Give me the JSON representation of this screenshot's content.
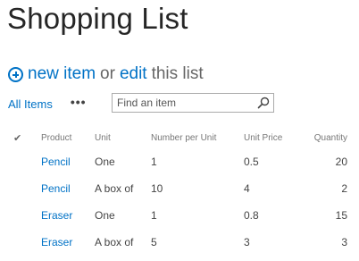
{
  "page": {
    "title": "Shopping List"
  },
  "commands": {
    "new_item": "new item",
    "or": "or",
    "edit": "edit",
    "this_list": "this list"
  },
  "view": {
    "current": "All Items",
    "more": "•••"
  },
  "search": {
    "placeholder": "Find an item",
    "value": ""
  },
  "table": {
    "columns": [
      "Product",
      "Unit",
      "Number per Unit",
      "Unit Price",
      "Quantity"
    ],
    "rows": [
      {
        "product": "Pencil",
        "unit": "One",
        "number_per_unit": "1",
        "unit_price": "0.5",
        "quantity": "20"
      },
      {
        "product": "Pencil",
        "unit": "A box of",
        "number_per_unit": "10",
        "unit_price": "4",
        "quantity": "2"
      },
      {
        "product": "Eraser",
        "unit": "One",
        "number_per_unit": "1",
        "unit_price": "0.8",
        "quantity": "15"
      },
      {
        "product": "Eraser",
        "unit": "A box of",
        "number_per_unit": "5",
        "unit_price": "3",
        "quantity": "3"
      }
    ]
  },
  "colors": {
    "accent": "#0072c6",
    "title": "#262626",
    "text": "#444444"
  },
  "icons": {
    "new_item": "plus-circle-icon",
    "search": "search-icon",
    "select_all": "check-icon"
  }
}
